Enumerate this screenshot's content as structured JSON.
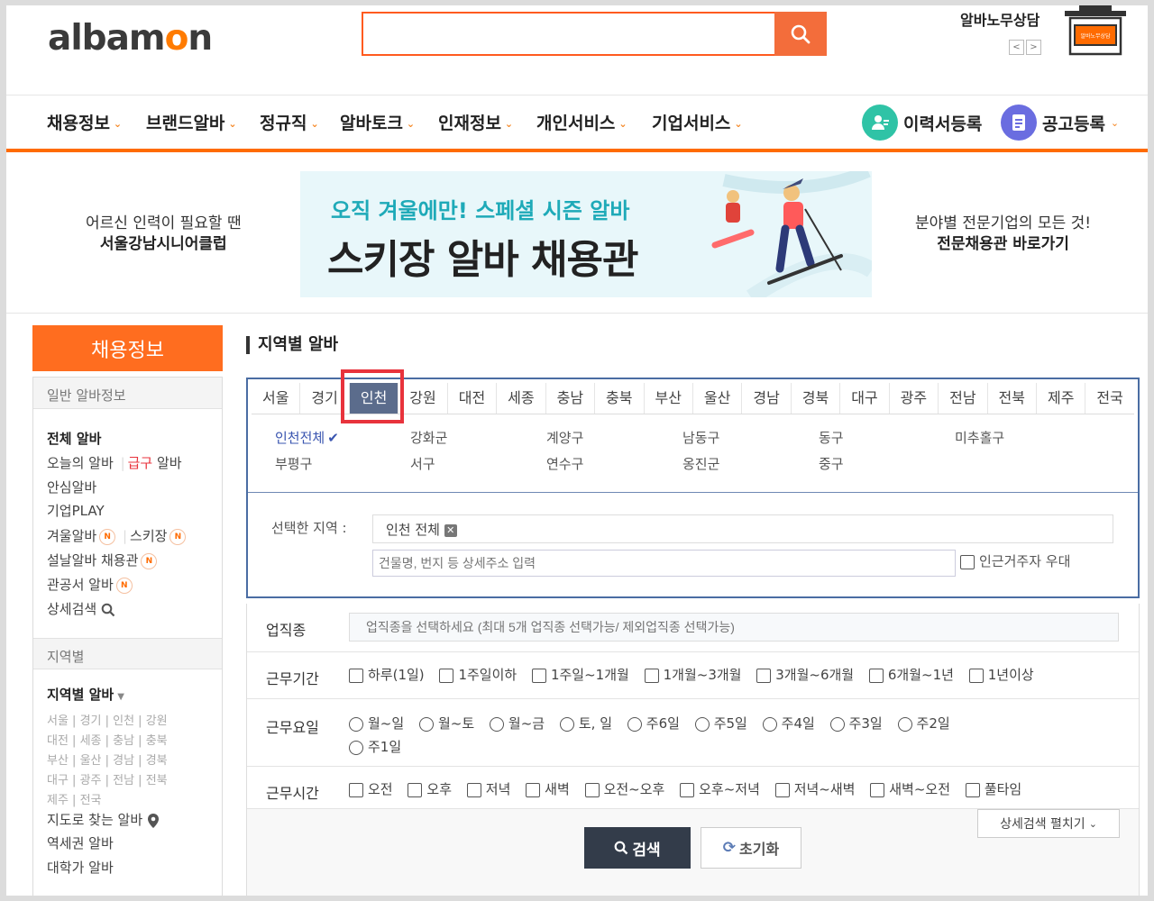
{
  "header": {
    "logo_pre": "alba",
    "logo_o": "m",
    "logo_mid": "o",
    "logo_post": "n",
    "logo_text": "albamon",
    "search_placeholder": "",
    "albanomu_title": "알바노무상담",
    "prev_label": "<",
    "next_label": ">",
    "desk_sign": "알바노무상담"
  },
  "nav": {
    "items": [
      {
        "label": "채용정보"
      },
      {
        "label": "브랜드알바"
      },
      {
        "label": "정규직"
      },
      {
        "label": "알바토크"
      },
      {
        "label": "인재정보"
      },
      {
        "label": "개인서비스"
      },
      {
        "label": "기업서비스"
      }
    ],
    "resume_label": "이력서등록",
    "post_label": "공고등록"
  },
  "banner": {
    "left_line1": "어르신 인력이 필요할 땐",
    "left_line2": "서울강남시니어클럽",
    "sub": "오직 겨울에만! 스페셜 시즌 알바",
    "title": "스키장 알바 채용관",
    "right_line1": "분야별 전문기업의 모든 것!",
    "right_line2": "전문채용관 바로가기"
  },
  "sidebar": {
    "header": "채용정보",
    "section1": "일반 알바정보",
    "all": "전체 알바",
    "today": "오늘의 알바",
    "urgent": "급구",
    "urgent_suffix": " 알바",
    "safe": "안심알바",
    "play": "기업PLAY",
    "winter": "겨울알바",
    "ski": "스키장",
    "seol": "설날알바 채용관",
    "gov": "관공서 알바",
    "detail": "상세검색",
    "badge": "N",
    "section2": "지역별",
    "region_title": "지역별 알바",
    "regions": [
      "서울 | 경기 | 인천 | 강원",
      "대전 | 세종 | 충남 | 충북",
      "부산 | 울산 | 경남 | 경북",
      "대구 | 광주 | 전남 | 전북",
      "제주 | 전국"
    ],
    "map": "지도로 찾는 알바",
    "station": "역세권 알바",
    "univ": "대학가 알바"
  },
  "main": {
    "title": "지역별 알바",
    "tabs": [
      "서울",
      "경기",
      "인천",
      "강원",
      "대전",
      "세종",
      "충남",
      "충북",
      "부산",
      "울산",
      "경남",
      "경북",
      "대구",
      "광주",
      "전남",
      "전북",
      "제주",
      "전국"
    ],
    "active_tab": "인천",
    "districts": [
      "인천전체",
      "강화군",
      "계양구",
      "남동구",
      "동구",
      "미추홀구",
      "부평구",
      "서구",
      "연수구",
      "옹진군",
      "중구"
    ],
    "selected_label": "선택한 지역 :",
    "selected_value": "인천 전체",
    "addr_placeholder": "건물명, 번지 등 상세주소 입력",
    "near_label": "인근거주자 우대"
  },
  "filters": {
    "job_label": "업직종",
    "job_placeholder": "업직종을 선택하세요 (최대 5개 업직종 선택가능/ 제외업직종 선택가능)",
    "period_label": "근무기간",
    "period_opts": [
      "하루(1일)",
      "1주일이하",
      "1주일~1개월",
      "1개월~3개월",
      "3개월~6개월",
      "6개월~1년",
      "1년이상"
    ],
    "days_label": "근무요일",
    "days_opts": [
      "월~일",
      "월~토",
      "월~금",
      "토, 일",
      "주6일",
      "주5일",
      "주4일",
      "주3일",
      "주2일",
      "주1일"
    ],
    "time_label": "근무시간",
    "time_opts": [
      "오전",
      "오후",
      "저녁",
      "새벽",
      "오전~오후",
      "오후~저녁",
      "저녁~새벽",
      "새벽~오전",
      "풀타임"
    ],
    "detail_btn": "상세검색 펼치기",
    "search_btn": "검색",
    "reset_btn": "초기화"
  },
  "colors": {
    "brand": "#ff6b00",
    "active_tab": "#5b6c8c",
    "box_border": "#4a6da3"
  }
}
